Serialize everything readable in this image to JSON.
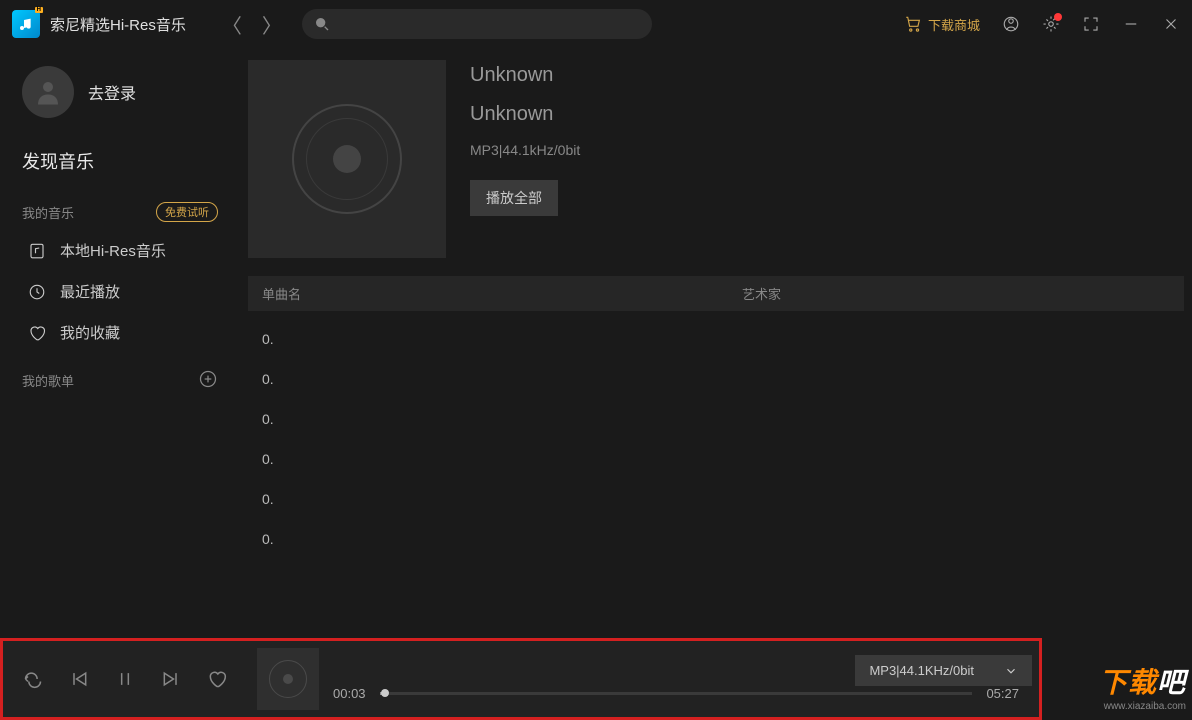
{
  "app": {
    "title": "索尼精选Hi-Res音乐"
  },
  "titlebar": {
    "shop_label": "下载商城"
  },
  "sidebar": {
    "login_label": "去登录",
    "discover": "发现音乐",
    "my_music_header": "我的音乐",
    "trial_label": "免费试听",
    "items": [
      {
        "label": "本地Hi-Res音乐"
      },
      {
        "label": "最近播放"
      },
      {
        "label": "我的收藏"
      }
    ],
    "playlist_header": "我的歌单"
  },
  "album": {
    "title": "Unknown",
    "artist": "Unknown",
    "format": "MP3|44.1kHz/0bit",
    "play_all": "播放全部"
  },
  "table": {
    "col_title": "单曲名",
    "col_artist": "艺术家",
    "rows": [
      {
        "label": "0."
      },
      {
        "label": "0."
      },
      {
        "label": "0."
      },
      {
        "label": "0."
      },
      {
        "label": "0."
      },
      {
        "label": "0."
      }
    ]
  },
  "player": {
    "elapsed": "00:03",
    "total": "05:27",
    "format_label": "MP3|44.1KHz/0bit"
  },
  "watermark": {
    "main_a": "下载",
    "main_b": "吧",
    "sub": "www.xiazaiba.com"
  }
}
